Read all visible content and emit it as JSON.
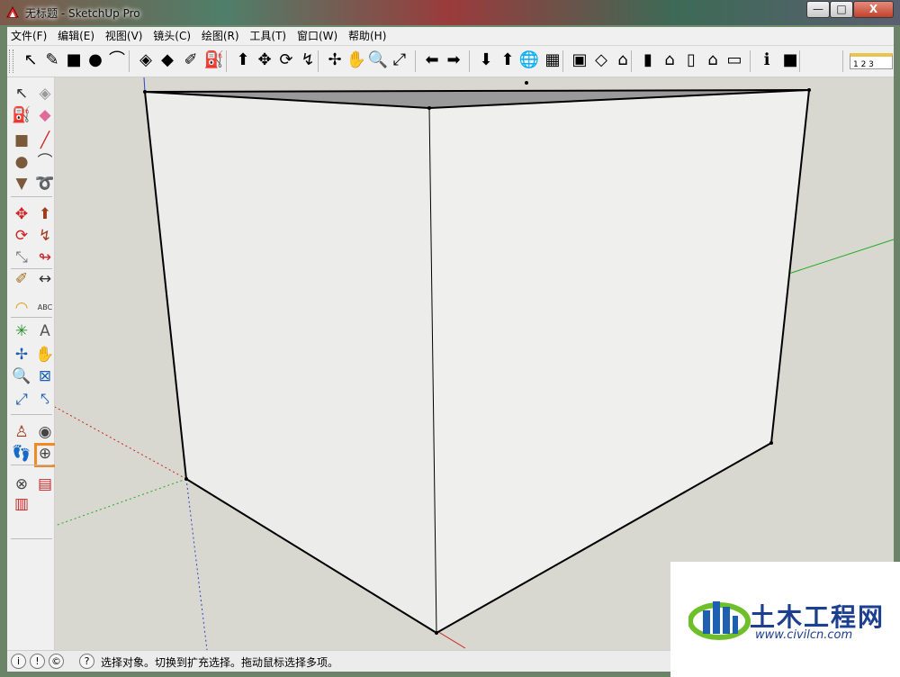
{
  "window": {
    "title": "无标题 - SketchUp Pro",
    "controls": {
      "minimize": "—",
      "maximize": "□",
      "close": "X"
    }
  },
  "menu": [
    "文件(F)",
    "编辑(E)",
    "视图(V)",
    "镜头(C)",
    "绘图(R)",
    "工具(T)",
    "窗口(W)",
    "帮助(H)"
  ],
  "toolbar": {
    "tools": [
      {
        "name": "select-tool-icon",
        "glyph": "↖"
      },
      {
        "name": "pencil-tool-icon",
        "glyph": "✎"
      },
      {
        "name": "rectangle-tool-icon",
        "glyph": "■"
      },
      {
        "name": "circle-tool-icon",
        "glyph": "●"
      },
      {
        "name": "arc-tool-icon",
        "glyph": "⌒"
      },
      {
        "name": "make-component-icon",
        "glyph": "◈"
      },
      {
        "name": "eraser-tool-icon",
        "glyph": "◆"
      },
      {
        "name": "tape-measure-icon",
        "glyph": "✐"
      },
      {
        "name": "paint-bucket-icon",
        "glyph": "⛽"
      },
      {
        "name": "push-pull-icon",
        "glyph": "⬆"
      },
      {
        "name": "move-tool-icon",
        "glyph": "✥"
      },
      {
        "name": "rotate-tool-icon",
        "glyph": "⟳"
      },
      {
        "name": "follow-me-icon",
        "glyph": "↯"
      },
      {
        "name": "orbit-tool-icon",
        "glyph": "✢"
      },
      {
        "name": "pan-tool-icon",
        "glyph": "✋"
      },
      {
        "name": "zoom-tool-icon",
        "glyph": "🔍"
      },
      {
        "name": "zoom-extents-icon",
        "glyph": "⤢"
      },
      {
        "name": "previous-view-icon",
        "glyph": "⬅"
      },
      {
        "name": "next-view-icon",
        "glyph": "➡"
      },
      {
        "name": "get-models-icon",
        "glyph": "⬇"
      },
      {
        "name": "share-model-icon",
        "glyph": "⬆"
      },
      {
        "name": "google-earth-icon",
        "glyph": "🌐"
      },
      {
        "name": "get-photo-texture-icon",
        "glyph": "▦"
      },
      {
        "name": "component-browser-icon",
        "glyph": "▣"
      },
      {
        "name": "dynamic-components-icon",
        "glyph": "◇"
      },
      {
        "name": "iso-view-icon",
        "glyph": "⌂"
      },
      {
        "name": "top-view-icon",
        "glyph": "▮"
      },
      {
        "name": "front-view-icon",
        "glyph": "⌂"
      },
      {
        "name": "right-view-icon",
        "glyph": "▯"
      },
      {
        "name": "back-view-icon",
        "glyph": "⌂"
      },
      {
        "name": "left-view-icon",
        "glyph": "▭"
      },
      {
        "name": "model-info-icon",
        "glyph": "ℹ"
      },
      {
        "name": "solid-tools-icon",
        "glyph": "■"
      }
    ],
    "layer_value": "1  2  3"
  },
  "left_toolbar": {
    "tools": [
      {
        "name": "select-tool-icon",
        "glyph": "↖"
      },
      {
        "name": "make-component-icon",
        "glyph": "◈"
      },
      {
        "name": "paint-bucket-icon",
        "glyph": "⛽"
      },
      {
        "name": "eraser-tool-icon",
        "glyph": "◆"
      },
      {
        "name": "rectangle-tool-icon",
        "glyph": "■"
      },
      {
        "name": "line-tool-icon",
        "glyph": "╱"
      },
      {
        "name": "circle-tool-icon",
        "glyph": "●"
      },
      {
        "name": "arc-tool-icon",
        "glyph": "⌒"
      },
      {
        "name": "polygon-tool-icon",
        "glyph": "▼"
      },
      {
        "name": "freehand-tool-icon",
        "glyph": "➰"
      },
      {
        "name": "move-tool-icon",
        "glyph": "✥"
      },
      {
        "name": "push-pull-icon",
        "glyph": "⬆"
      },
      {
        "name": "rotate-tool-icon",
        "glyph": "⟳"
      },
      {
        "name": "follow-me-icon",
        "glyph": "↯"
      },
      {
        "name": "scale-tool-icon",
        "glyph": "⤡"
      },
      {
        "name": "offset-tool-icon",
        "glyph": "↬"
      },
      {
        "name": "tape-measure-icon",
        "glyph": "✐"
      },
      {
        "name": "dimension-tool-icon",
        "glyph": "↔"
      },
      {
        "name": "protractor-tool-icon",
        "glyph": "◠"
      },
      {
        "name": "text-tool-icon",
        "glyph": "ABC"
      },
      {
        "name": "axes-tool-icon",
        "glyph": "✳"
      },
      {
        "name": "3d-text-tool-icon",
        "glyph": "A"
      },
      {
        "name": "orbit-tool-icon",
        "glyph": "✢"
      },
      {
        "name": "pan-tool-icon",
        "glyph": "✋"
      },
      {
        "name": "zoom-tool-icon",
        "glyph": "🔍"
      },
      {
        "name": "zoom-window-icon",
        "glyph": "⊠"
      },
      {
        "name": "zoom-extents-icon",
        "glyph": "⤢"
      },
      {
        "name": "previous-view-icon",
        "glyph": "⤣"
      },
      {
        "name": "position-camera-icon",
        "glyph": "♙"
      },
      {
        "name": "look-around-icon",
        "glyph": "◉"
      },
      {
        "name": "walk-tool-icon",
        "glyph": "👣"
      },
      {
        "name": "section-plane-icon",
        "glyph": "⊕"
      },
      {
        "name": "sandbox-from-contours-icon",
        "glyph": "⊗"
      },
      {
        "name": "sandbox-from-scratch-icon",
        "glyph": "▤"
      },
      {
        "name": "sandbox-smoove-icon",
        "glyph": "▥"
      }
    ],
    "selected": "zoom-window-icon"
  },
  "status": {
    "text": "选择对象。切换到扩充选择。拖动鼠标选择多项。",
    "icons": [
      "i",
      "!",
      "©",
      "?"
    ]
  },
  "watermark": {
    "title": "土木工程网",
    "url": "www.civilcn.com"
  },
  "colors": {
    "selection_highlight": "#f08a24",
    "axis_red": "#cc2222",
    "axis_green": "#22aa22",
    "axis_blue": "#3344cc",
    "model_face": "#ececea",
    "model_top": "#9a9a9a"
  }
}
